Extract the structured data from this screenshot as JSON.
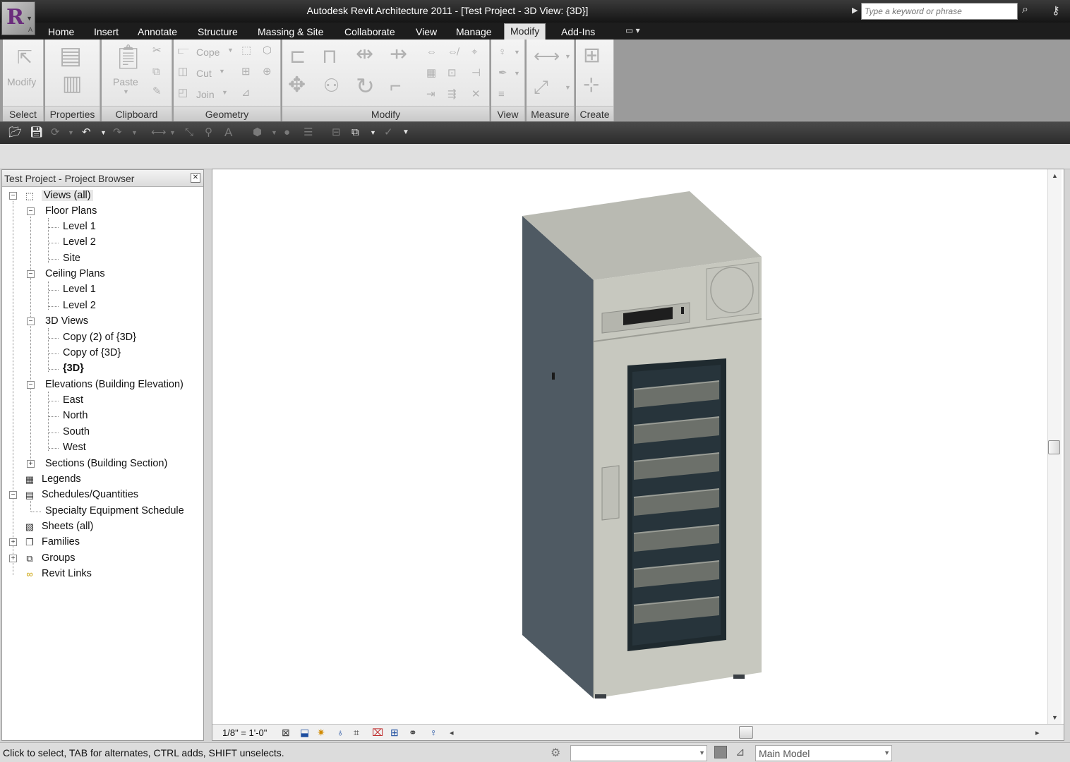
{
  "window": {
    "title": "Autodesk Revit Architecture 2011 - [Test Project - 3D View: {3D}]",
    "search_placeholder": "Type a keyword or phrase",
    "app_logo_letter": "R",
    "app_logo_sub": "A"
  },
  "tabs": [
    {
      "label": "Home"
    },
    {
      "label": "Insert"
    },
    {
      "label": "Annotate"
    },
    {
      "label": "Structure"
    },
    {
      "label": "Massing & Site"
    },
    {
      "label": "Collaborate"
    },
    {
      "label": "View"
    },
    {
      "label": "Manage"
    },
    {
      "label": "Modify",
      "active": true
    },
    {
      "label": "Add-Ins"
    }
  ],
  "ribbon": {
    "panels": {
      "select": "Select",
      "properties": "Properties",
      "clipboard": "Clipboard",
      "geometry": "Geometry",
      "modify": "Modify",
      "view": "View",
      "measure": "Measure",
      "create": "Create"
    },
    "buttons": {
      "modify": "Modify",
      "paste": "Paste",
      "cope": "Cope",
      "cut": "Cut",
      "join": "Join"
    }
  },
  "browser": {
    "title": "Test Project - Project Browser",
    "nodes": {
      "views_all": "Views (all)",
      "floor_plans": "Floor Plans",
      "fp_level1": "Level 1",
      "fp_level2": "Level 2",
      "fp_site": "Site",
      "ceiling_plans": "Ceiling Plans",
      "cp_level1": "Level 1",
      "cp_level2": "Level 2",
      "views_3d": "3D Views",
      "v3d_copy2": "Copy (2) of {3D}",
      "v3d_copy": "Copy of {3D}",
      "v3d_main": "{3D}",
      "elevations": "Elevations (Building Elevation)",
      "el_east": "East",
      "el_north": "North",
      "el_south": "South",
      "el_west": "West",
      "sections": "Sections (Building Section)",
      "legends": "Legends",
      "schedules": "Schedules/Quantities",
      "specialty_schedule": "Specialty Equipment Schedule",
      "sheets": "Sheets (all)",
      "families": "Families",
      "groups": "Groups",
      "revit_links": "Revit Links"
    }
  },
  "view_control": {
    "scale": "1/8\" = 1'-0\""
  },
  "status": {
    "message": "Click to select, TAB for alternates, CTRL adds, SHIFT unselects.",
    "workset": "",
    "design_option": "Main Model"
  },
  "colors": {
    "cabinet_front": "#c7c8bf",
    "cabinet_side": "#4f5a63",
    "cabinet_top": "#b9bab2",
    "accent_tab": "#e4e4e4"
  }
}
